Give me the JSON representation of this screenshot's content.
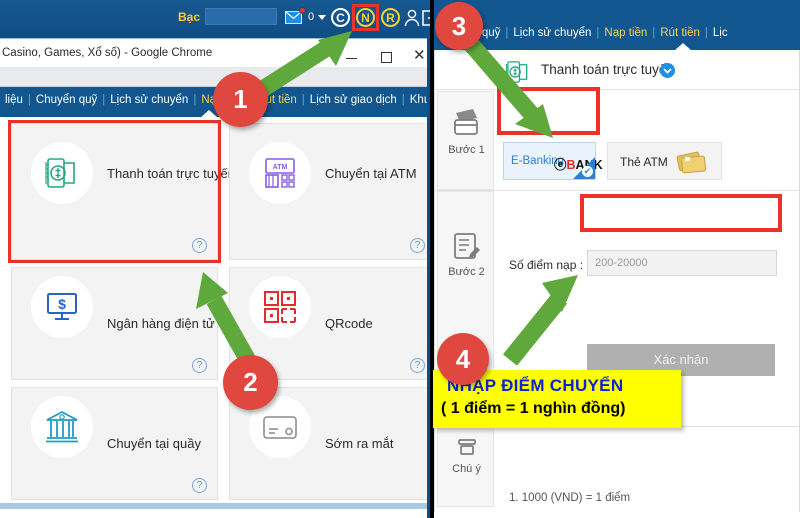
{
  "left_panel": {
    "topbar": {
      "balance_label": "Bạc",
      "balance_value": "",
      "mail_count": "0",
      "icons": [
        "mail-icon",
        "caret-down-icon",
        "circle-c-icon",
        "circle-n-icon",
        "circle-r-icon",
        "person-icon",
        "logout-icon"
      ],
      "circle_c": "C",
      "circle_n": "N",
      "circle_r": "R"
    },
    "chrome_window": {
      "title": "Casino, Games, Xổ số) - Google Chrome",
      "minimize": "—",
      "maximize": "□",
      "close": "✕"
    },
    "nav": {
      "items": [
        {
          "label": "liệu",
          "active": false
        },
        {
          "label": "Chuyển quỹ",
          "active": false
        },
        {
          "label": "Lịch sử chuyển",
          "active": false
        },
        {
          "label": "Nạp tiền",
          "active": true
        },
        {
          "label": "Rút tiền",
          "active": true
        },
        {
          "label": "Lịch sử giao dịch",
          "active": false
        },
        {
          "label": "Khuyến mã",
          "active": false
        }
      ]
    },
    "cards": [
      {
        "label": "Thanh toán trực tuyến",
        "icon": "mobile-money-icon",
        "help": "?"
      },
      {
        "label": "Chuyển tại ATM",
        "icon": "atm-machine-icon",
        "help": "?"
      },
      {
        "label": "Ngân hàng điện tử",
        "icon": "monitor-dollar-icon",
        "help": "?"
      },
      {
        "label": "QRcode",
        "icon": "qrcode-icon",
        "help": "?"
      },
      {
        "label": "Chuyển tại quầy",
        "icon": "bank-building-icon",
        "help": "?"
      },
      {
        "label": "Sớm ra mắt",
        "icon": "credit-card-icon",
        "help": ""
      }
    ]
  },
  "right_panel": {
    "nav": {
      "items": [
        {
          "label": "Chuyển quỹ",
          "active": false
        },
        {
          "label": "Lịch sử chuyển",
          "active": false
        },
        {
          "label": "Nạp tiền",
          "active": true
        },
        {
          "label": "Rút tiền",
          "active": true
        },
        {
          "label": "Lịc",
          "active": false
        }
      ]
    },
    "header": {
      "title": "Thanh toán trực tuyến",
      "icon": "mobile-money-icon",
      "chevron": "chevron-down-icon"
    },
    "step1": {
      "label": "Bước 1",
      "icon": "cards-icon",
      "tabs": [
        {
          "label": "E-Banking",
          "logo_prefix": "ⓔ",
          "logo_red": "B",
          "logo_rest": "ANK",
          "selected": true
        },
        {
          "label": "Thẻ ATM",
          "icon": "wallet-cards-icon",
          "selected": false
        }
      ]
    },
    "step2": {
      "label": "Bước 2",
      "icon": "form-edit-icon",
      "field_label": "Số điểm nạp :",
      "field_placeholder": "200-20000",
      "field_value": "",
      "confirm_button": "Xác nhận"
    },
    "step3": {
      "label": "Chú ý",
      "icon": "note-icon",
      "notes": [
        "1.  1000 (VND) = 1 điểm"
      ]
    }
  },
  "annotations": {
    "badges": [
      "1",
      "2",
      "3",
      "4"
    ],
    "callout": {
      "line1": "NHẬP ĐIỂM CHUYỂN",
      "line2": "( 1 điểm = 1 nghìn đồng)"
    },
    "colors": {
      "badge": "#e0473e",
      "arrow": "#5fa83c",
      "highlight_box": "#e8322a",
      "callout_bg": "#ffff00",
      "callout_text": "#0b23d6"
    }
  }
}
